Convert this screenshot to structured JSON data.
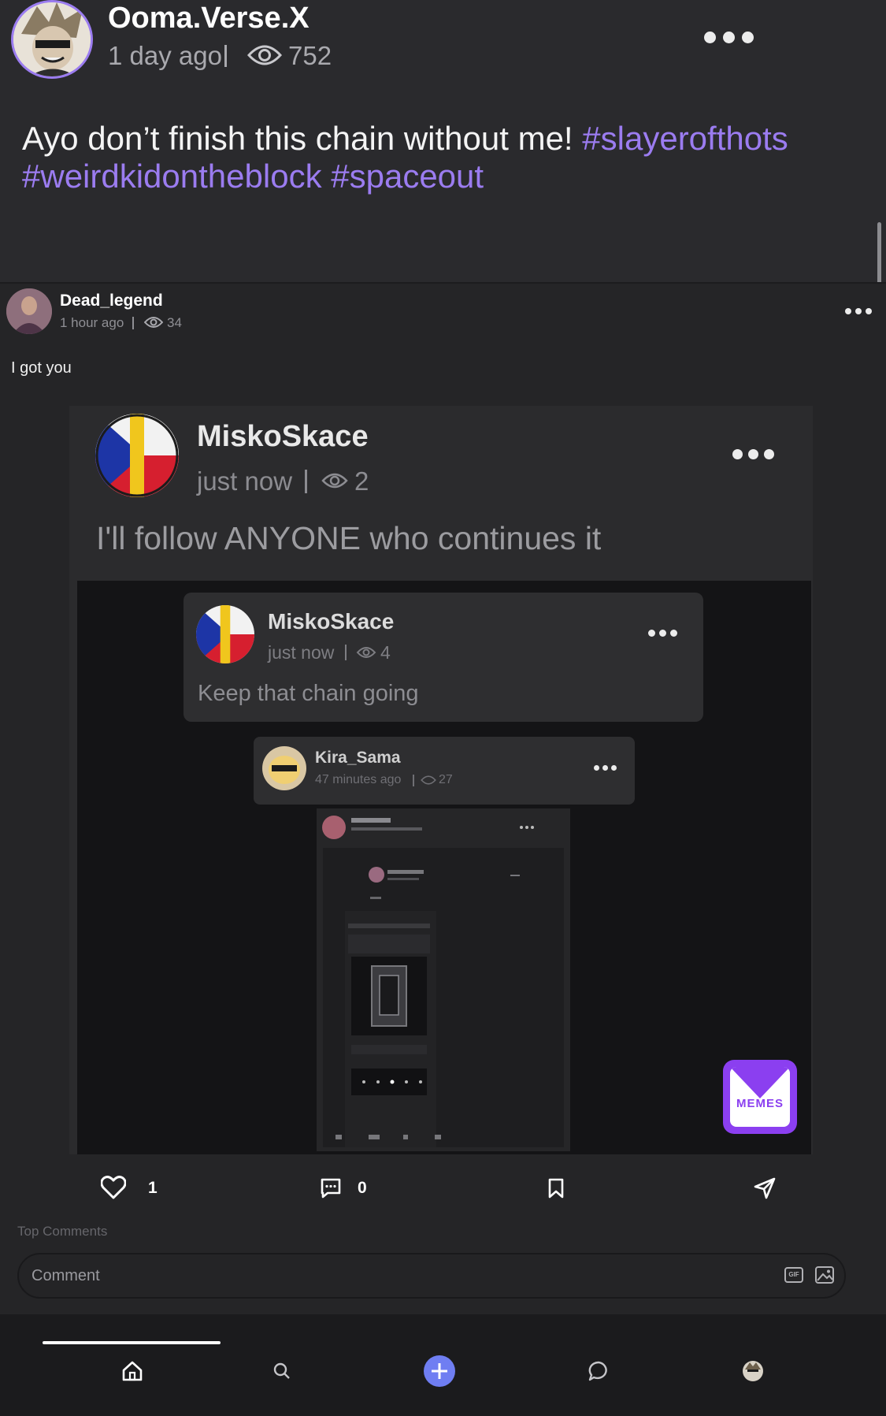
{
  "post": {
    "author": "Ooma.Verse.X",
    "time": "1 day ago",
    "views": "752",
    "text": "Ayo don’t finish this chain without me! ",
    "hashtags_line1": "#slayerofthots",
    "hashtags_line2a": "#weirdkidontheblock",
    "hashtags_line2b": "#spaceout"
  },
  "shared": {
    "author": "Dead_legend",
    "time": "1 hour ago",
    "views": "34",
    "text": "I got you"
  },
  "level1": {
    "author": "MiskoSkace",
    "time": "just now",
    "views": "2",
    "text": "I'll follow ANYONE who continues it"
  },
  "level2": {
    "author": "MiskoSkace",
    "time": "just now",
    "views": "4",
    "text": "Keep that chain going"
  },
  "level3": {
    "author": "Kira_Sama",
    "time": "47 minutes ago",
    "views": "27"
  },
  "memes_badge": "MEMES",
  "actions": {
    "likes": "1",
    "comments": "0"
  },
  "top_comments_label": "Top Comments",
  "comment_input": {
    "placeholder": "Comment",
    "gif_label": "GIF"
  },
  "colors": {
    "background": "#2a2a2d",
    "accent": "#9b7cf0",
    "fab": "#6f7ef2",
    "memes": "#8b3ff0"
  },
  "nav": [
    "home-icon",
    "search-icon",
    "create-plus-icon",
    "chat-icon",
    "profile-avatar"
  ]
}
